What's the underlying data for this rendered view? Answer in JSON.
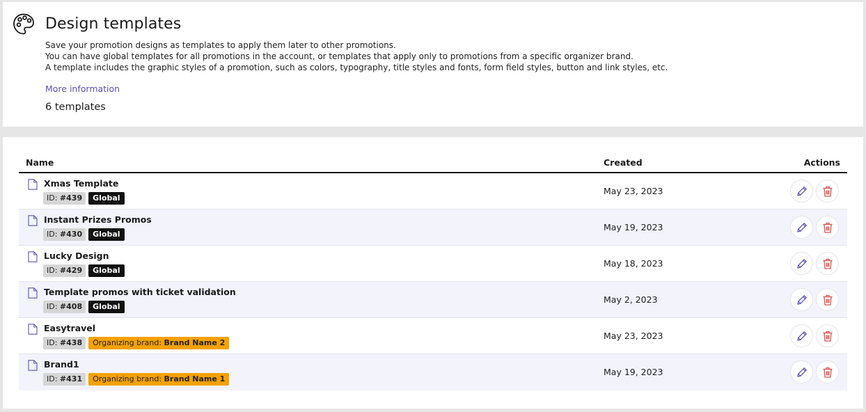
{
  "header": {
    "icon": "palette-icon",
    "title": "Design templates",
    "description": [
      "Save your promotion designs as templates to apply them later to other promotions.",
      "You can have global templates for all promotions in the account, or templates that apply only to promotions from a specific organizer brand.",
      "A template includes the graphic styles of a promotion, such as colors, typography, title styles and fonts, form field styles, button and link styles, etc."
    ],
    "more_link": "More information",
    "count": "6 templates"
  },
  "table": {
    "columns": {
      "name": "Name",
      "created": "Created",
      "actions": "Actions"
    },
    "id_prefix": "ID: ",
    "brand_prefix": "Organizing brand: ",
    "rows": [
      {
        "name": "Xmas Template",
        "id": "#439",
        "global": "Global",
        "created": "May 23, 2023"
      },
      {
        "name": "Instant Prizes Promos",
        "id": "#430",
        "global": "Global",
        "created": "May 19, 2023"
      },
      {
        "name": "Lucky Design",
        "id": "#429",
        "global": "Global",
        "created": "May 18, 2023"
      },
      {
        "name": "Template promos with ticket validation",
        "id": "#408",
        "global": "Global",
        "created": "May 2, 2023"
      },
      {
        "name": "Easytravel",
        "id": "#438",
        "brand": "Brand Name 2",
        "created": "May 23, 2023"
      },
      {
        "name": "Brand1",
        "id": "#431",
        "brand": "Brand Name 1",
        "created": "May 19, 2023"
      }
    ]
  },
  "icons": {
    "row": "document-icon",
    "edit": "pencil-icon",
    "delete": "trash-icon"
  },
  "colors": {
    "link": "#5a52b8",
    "edit_icon": "#5a52b8",
    "delete_icon": "#d9534f",
    "global_tag": "#111111",
    "brand_tag": "#f5a100",
    "row_alt": "#f2f3fb"
  }
}
